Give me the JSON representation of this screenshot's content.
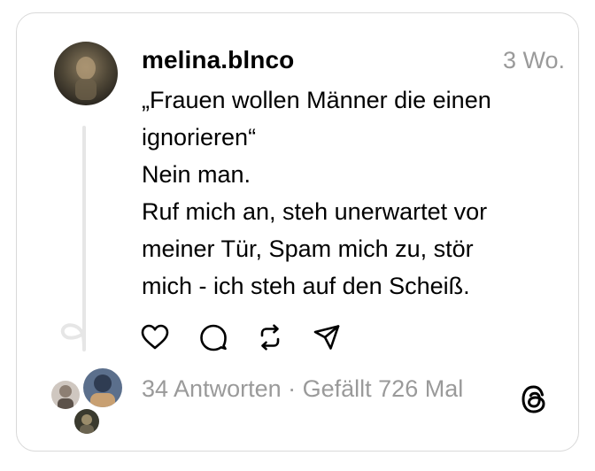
{
  "post": {
    "username": "melina.blnco",
    "timestamp": "3 Wo.",
    "lines": [
      "„Frauen wollen Männer die einen",
      "ignorieren“",
      "Nein man.",
      "Ruf mich an, steh unerwartet vor",
      "meiner Tür, Spam mich zu, stör",
      "mich - ich steh auf den Scheiß."
    ]
  },
  "actions": {
    "icons": [
      "heart-icon",
      "comment-icon",
      "repost-icon",
      "share-icon"
    ]
  },
  "footer": {
    "replies": "34 Antworten",
    "separator": " · ",
    "likes": "Gefällt 726 Mal",
    "logo_icon": "threads-logo-icon"
  }
}
